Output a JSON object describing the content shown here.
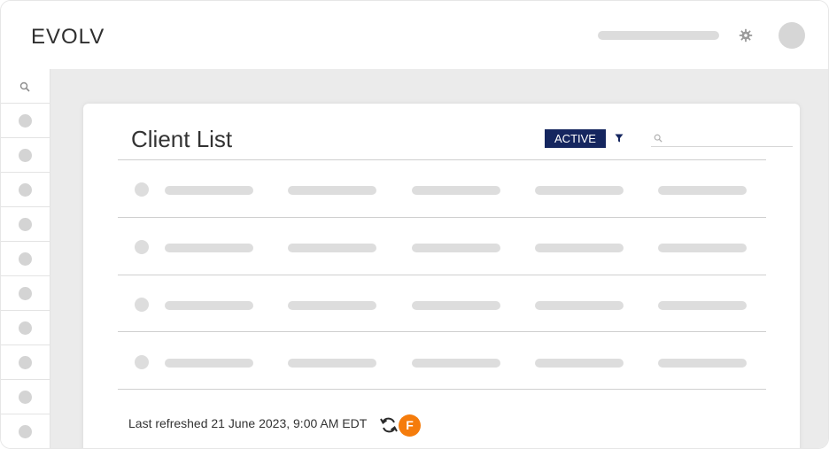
{
  "app": {
    "title": "EVOLV"
  },
  "header": {
    "settings_icon": "gear-icon",
    "avatar_icon": "avatar-circle"
  },
  "sidebar": {
    "search_icon": "search-icon",
    "item_count": 10
  },
  "card": {
    "title": "Client List",
    "status_badge": "ACTIVE",
    "filter_icon": "filter-icon",
    "search": {
      "placeholder": "",
      "value": ""
    },
    "rows": 4,
    "columns": 5
  },
  "footer": {
    "last_refreshed": "Last refreshed 21 June 2023, 9:00 AM EDT",
    "refresh_icon": "refresh-icon",
    "user_badge": "F"
  },
  "colors": {
    "badge_bg": "#15265f",
    "user_badge_bg": "#f57c0c",
    "skeleton": "#dddddd",
    "background": "#ebebeb"
  }
}
